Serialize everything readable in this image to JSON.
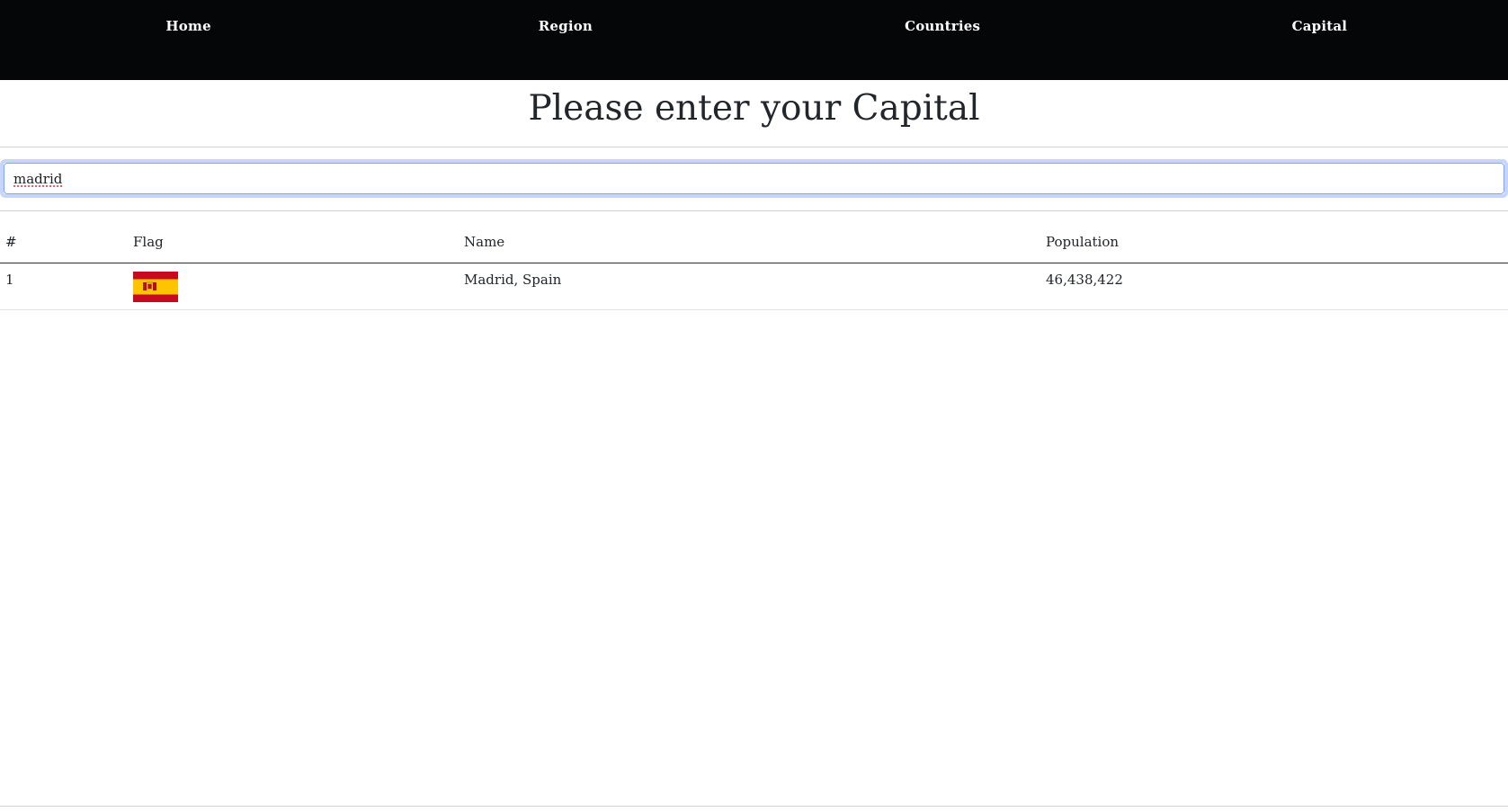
{
  "nav": {
    "items": [
      {
        "label": "Home"
      },
      {
        "label": "Region"
      },
      {
        "label": "Countries"
      },
      {
        "label": "Capital"
      }
    ]
  },
  "page": {
    "title": "Please enter your Capital"
  },
  "search": {
    "value": "madrid",
    "placeholder": ""
  },
  "table": {
    "headers": [
      "#",
      "Flag",
      "Name",
      "Population"
    ],
    "rows": [
      {
        "index": "1",
        "flag_icon": "spain-flag-icon",
        "name": "Madrid, Spain",
        "population": "46,438,422"
      }
    ]
  },
  "colors": {
    "navbar_bg": "#050608",
    "nav_text": "#ffffff",
    "focus_ring": "#c6d6fb",
    "flag_red": "#c60b1e",
    "flag_yellow": "#ffc400"
  }
}
